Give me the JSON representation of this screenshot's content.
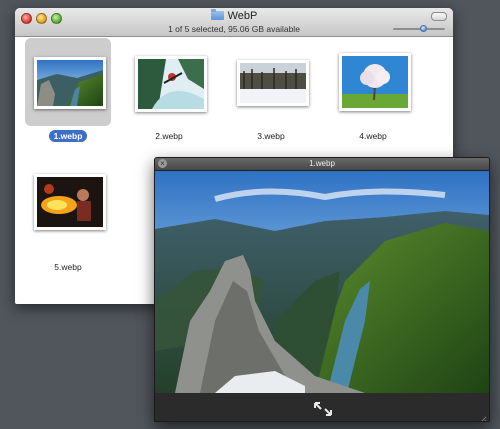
{
  "finder": {
    "title": "WebP",
    "status": "1 of 5 selected, 95.06 GB available",
    "items": [
      {
        "label": "1.webp",
        "selected": true
      },
      {
        "label": "2.webp",
        "selected": false
      },
      {
        "label": "3.webp",
        "selected": false
      },
      {
        "label": "4.webp",
        "selected": false
      },
      {
        "label": "5.webp",
        "selected": false
      }
    ],
    "zoom_level": 0.6
  },
  "viewer": {
    "title": "1.webp",
    "close_icon": "×"
  },
  "colors": {
    "selection": "#3e6fc8",
    "desktop": "#50565c"
  }
}
